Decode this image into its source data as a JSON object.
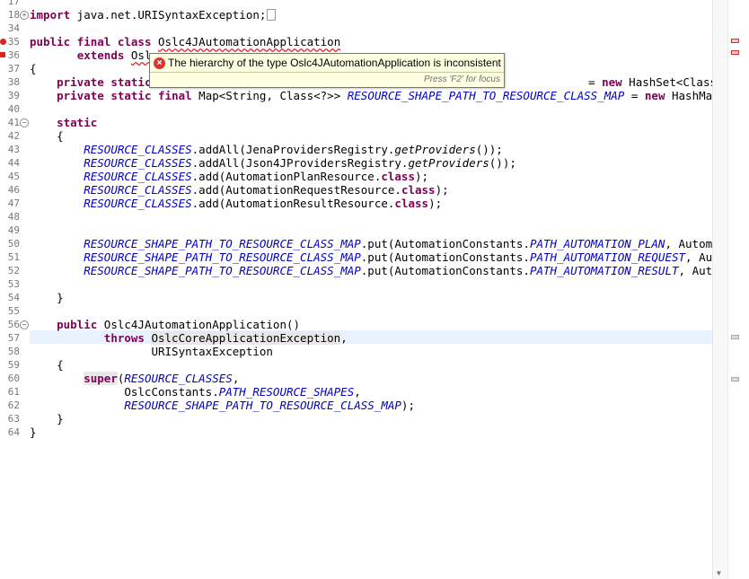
{
  "editor": {
    "line_numbers": [
      "17",
      "18",
      "34",
      "35",
      "36",
      "37",
      "38",
      "39",
      "40",
      "41",
      "42",
      "43",
      "44",
      "45",
      "46",
      "47",
      "48",
      "49",
      "50",
      "51",
      "52",
      "53",
      "54",
      "55",
      "56",
      "57",
      "58",
      "59",
      "60",
      "61",
      "62",
      "63",
      "64"
    ],
    "lines": {
      "l18": {
        "kw1": "import",
        "rest": " java.net.URISyntaxException;"
      },
      "l35": {
        "kw1": "public",
        "kw2": "final",
        "kw3": "class",
        "name": "Oslc4JAutomationApplication"
      },
      "l36": {
        "kw": "extends",
        "name": "Oslc"
      },
      "l37": "{",
      "l38": {
        "kw1": "private",
        "kw2": "static",
        "tail_new": "new",
        "tail": " HashSet<Class<"
      },
      "l39": {
        "kw1": "private",
        "kw2": "static",
        "kw3": "final",
        "type": " Map<String, Class<?>> ",
        "field": "RESOURCE_SHAPE_PATH_TO_RESOURCE_CLASS_MAP",
        "eq": " = ",
        "new": "new",
        "tail": " HashMap<String"
      },
      "l41": {
        "kw": "static"
      },
      "l42": "{",
      "l43": {
        "field": "RESOURCE_CLASSES",
        "a": ".addAll(JenaProvidersRegistry.",
        "m": "getProviders",
        "b": "());"
      },
      "l44": {
        "field": "RESOURCE_CLASSES",
        "a": ".addAll(Json4JProvidersRegistry.",
        "m": "getProviders",
        "b": "());"
      },
      "l45": {
        "field": "RESOURCE_CLASSES",
        "a": ".add(AutomationPlanResource.",
        "kw": "class",
        "b": ");"
      },
      "l46": {
        "field": "RESOURCE_CLASSES",
        "a": ".add(AutomationRequestResource.",
        "kw": "class",
        "b": ");"
      },
      "l47": {
        "field": "RESOURCE_CLASSES",
        "a": ".add(AutomationResultResource.",
        "kw": "class",
        "b": ");"
      },
      "l50": {
        "field": "RESOURCE_SHAPE_PATH_TO_RESOURCE_CLASS_MAP",
        "a": ".put(AutomationConstants.",
        "f2": "PATH_AUTOMATION_PLAN",
        "b": ", AutomationPla"
      },
      "l51": {
        "field": "RESOURCE_SHAPE_PATH_TO_RESOURCE_CLASS_MAP",
        "a": ".put(AutomationConstants.",
        "f2": "PATH_AUTOMATION_REQUEST",
        "b": ", Automation"
      },
      "l52": {
        "field": "RESOURCE_SHAPE_PATH_TO_RESOURCE_CLASS_MAP",
        "a": ".put(AutomationConstants.",
        "f2": "PATH_AUTOMATION_RESULT",
        "b": ", Automation"
      },
      "l54": "}",
      "l56": {
        "kw": "public",
        "rest": " Oslc4JAutomationApplication()"
      },
      "l57": {
        "kw": "throws",
        "occ": "OslcCoreApplicationException",
        "rest": ","
      },
      "l58": "URISyntaxException",
      "l59": "{",
      "l60": {
        "kw": "super",
        "a": "(",
        "field": "RESOURCE_CLASSES",
        "b": ","
      },
      "l61": {
        "a": "OslcConstants.",
        "field": "PATH_RESOURCE_SHAPES",
        "b": ","
      },
      "l62": {
        "field": "RESOURCE_SHAPE_PATH_TO_RESOURCE_CLASS_MAP",
        "b": ");"
      },
      "l63": "}",
      "l64": "}"
    }
  },
  "hover": {
    "message": "The hierarchy of the type Oslc4JAutomationApplication is inconsistent",
    "status": "Press 'F2' for focus"
  },
  "colors": {
    "keyword": "#7f0055",
    "field": "#0000c0",
    "error": "#d22222",
    "hover_bg": "#ffffe1"
  }
}
